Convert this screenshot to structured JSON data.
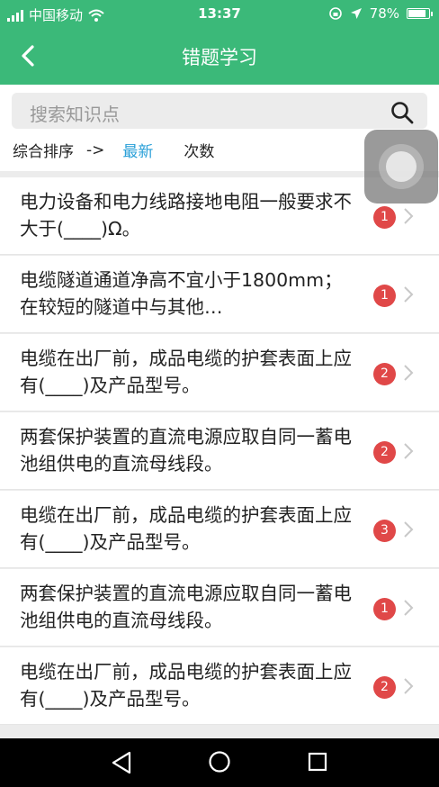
{
  "status": {
    "carrier": "中国移动",
    "time": "13:37",
    "battery": "78%"
  },
  "header": {
    "title": "错题学习"
  },
  "search": {
    "placeholder": "搜索知识点"
  },
  "sort": {
    "label": "综合排序",
    "arrow": "->",
    "latest": "最新",
    "count": "次数"
  },
  "items": [
    {
      "text": "电力设备和电力线路接地电阻一般要求不大于(____)Ω。",
      "count": "1"
    },
    {
      "text": "电缆隧道通道净高不宜小于1800mm；在较短的隧道中与其他…",
      "count": "1"
    },
    {
      "text": "电缆在出厂前，成品电缆的护套表面上应有(____)及产品型号。",
      "count": "2"
    },
    {
      "text": "两套保护装置的直流电源应取自同一蓄电池组供电的直流母线段。",
      "count": "2"
    },
    {
      "text": "电缆在出厂前，成品电缆的护套表面上应有(____)及产品型号。",
      "count": "3"
    },
    {
      "text": "两套保护装置的直流电源应取自同一蓄电池组供电的直流母线段。",
      "count": "1"
    },
    {
      "text": "电缆在出厂前，成品电缆的护套表面上应有(____)及产品型号。",
      "count": "2"
    }
  ],
  "colors": {
    "brand": "#3bb979",
    "accent": "#2aa0d8",
    "badge": "#e04848"
  }
}
